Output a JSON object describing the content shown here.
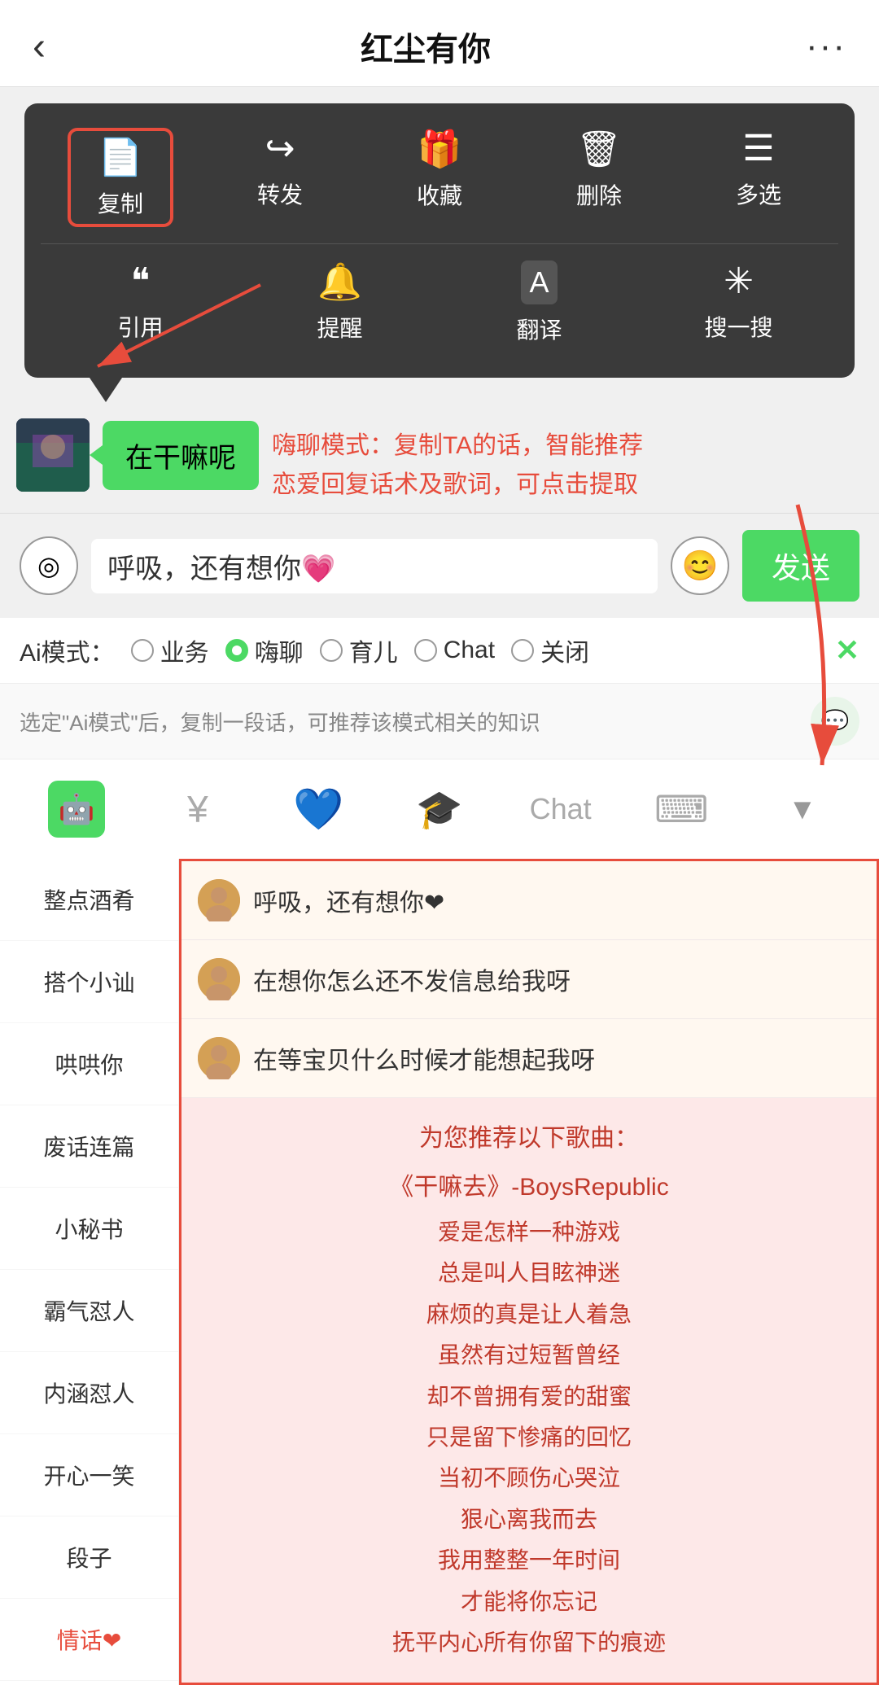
{
  "header": {
    "back": "‹",
    "title": "红尘有你",
    "more": "···"
  },
  "context_menu": {
    "row1": [
      {
        "icon": "📄",
        "label": "复制",
        "highlighted": true
      },
      {
        "icon": "↪",
        "label": "转发"
      },
      {
        "icon": "🎁",
        "label": "收藏"
      },
      {
        "icon": "🗑",
        "label": "删除"
      },
      {
        "icon": "☰",
        "label": "多选"
      }
    ],
    "row2": [
      {
        "icon": "❝",
        "label": "引用"
      },
      {
        "icon": "🔔",
        "label": "提醒"
      },
      {
        "icon": "A",
        "label": "翻译"
      },
      {
        "icon": "✳",
        "label": "搜一搜"
      }
    ]
  },
  "chat": {
    "bubble_text": "在干嘛呢",
    "input_value": "呼吸，还有想你💗",
    "send_label": "发送"
  },
  "annotation": {
    "text": "嗨聊模式：复制TA的话，智能推荐\n恋爱回复话术及歌词，可点击提取"
  },
  "ai_modes": {
    "label": "Ai模式：",
    "options": [
      {
        "label": "业务",
        "active": false
      },
      {
        "label": "嗨聊",
        "active": true
      },
      {
        "label": "育儿",
        "active": false
      },
      {
        "label": "Chat",
        "active": false
      },
      {
        "label": "关闭",
        "active": false
      }
    ],
    "close": "✕"
  },
  "hint": {
    "text": "选定\"Ai模式\"后，复制一段话，可推荐该模式相关的知识"
  },
  "toolbar": {
    "items": [
      {
        "icon": "🤖",
        "type": "robot",
        "label": "chat"
      },
      {
        "icon": "¥",
        "label": "pay"
      },
      {
        "icon": "💙",
        "label": "heart"
      },
      {
        "icon": "🎓",
        "label": "study"
      },
      {
        "icon": "Chat",
        "label": "chat-text"
      },
      {
        "icon": "⌨",
        "label": "keyboard"
      },
      {
        "icon": "▼",
        "label": "collapse"
      }
    ]
  },
  "sidebar": {
    "items": [
      {
        "label": "整点酒肴"
      },
      {
        "label": "搭个小讪"
      },
      {
        "label": "哄哄你"
      },
      {
        "label": "废话连篇"
      },
      {
        "label": "小秘书"
      },
      {
        "label": "霸气怼人"
      },
      {
        "label": "内涵怼人"
      },
      {
        "label": "开心一笑"
      },
      {
        "label": "段子"
      },
      {
        "label": "情话❤"
      }
    ]
  },
  "replies": [
    {
      "text": "呼吸，还有想你❤"
    },
    {
      "text": "在想你怎么还不发信息给我呀"
    },
    {
      "text": "在等宝贝什么时候才能想起我呀"
    }
  ],
  "songs": {
    "intro": "为您推荐以下歌曲：",
    "song_name": "《干嘛去》-BoysRepublic",
    "lyrics": [
      "爱是怎样一种游戏",
      "总是叫人目眩神迷",
      "麻烦的真是让人着急",
      "虽然有过短暂曾经",
      "却不曾拥有爱的甜蜜",
      "只是留下惨痛的回忆",
      "当初不顾伤心哭泣",
      "狠心离我而去",
      "我用整整一年时间",
      "才能将你忘记",
      "抚平内心所有你留下的痕迹"
    ]
  }
}
